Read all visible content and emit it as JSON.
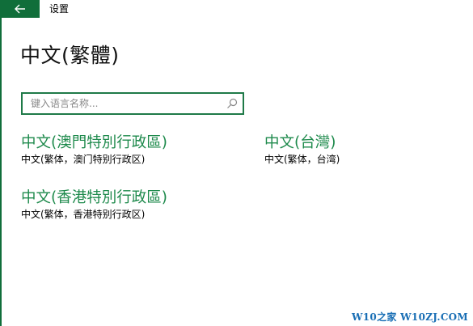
{
  "titlebar": {
    "title": "设置",
    "back_icon": "arrow-left-icon"
  },
  "page": {
    "title": "中文(繁體)"
  },
  "search": {
    "placeholder": "键入语言名称...",
    "value": "",
    "icon": "search-icon"
  },
  "languages": [
    {
      "name": "中文(澳門特別行政區)",
      "description": "中文(繁体，澳门特别行政区)"
    },
    {
      "name": "中文(台灣)",
      "description": "中文(繁体，台湾)"
    },
    {
      "name": "中文(香港特別行政區)",
      "description": "中文(繁体，香港特别行政区)"
    }
  ],
  "watermark": {
    "text": "W10之家 W10ZJ.COM"
  },
  "colors": {
    "accent": "#106e3a",
    "link": "#1e8a4c",
    "watermark": "#1a6fb5"
  }
}
